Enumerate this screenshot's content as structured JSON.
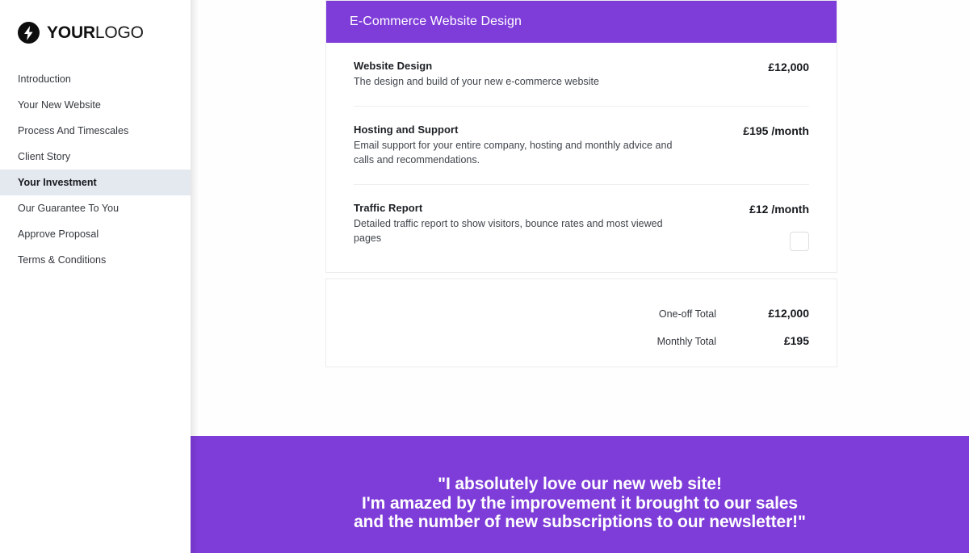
{
  "sidebar": {
    "logo": {
      "icon": "lightning-bolt-icon",
      "text_bold": "YOUR",
      "text_light": "LOGO"
    },
    "items": [
      {
        "label": "Introduction",
        "active": false
      },
      {
        "label": "Your New Website",
        "active": false
      },
      {
        "label": "Process And Timescales",
        "active": false
      },
      {
        "label": "Client Story",
        "active": false
      },
      {
        "label": "Your Investment",
        "active": true
      },
      {
        "label": "Our Guarantee To You",
        "active": false
      },
      {
        "label": "Approve Proposal",
        "active": false
      },
      {
        "label": "Terms & Conditions",
        "active": false
      }
    ]
  },
  "proposal": {
    "card_title": "E-Commerce Website Design",
    "line_items": [
      {
        "title": "Website Design",
        "description": "The design and build of your new e-commerce website",
        "price": "£12,000",
        "has_checkbox": false
      },
      {
        "title": "Hosting and Support",
        "description": "Email support for your entire company, hosting and monthly advice and calls and recommendations.",
        "price": "£195 /month",
        "has_checkbox": false
      },
      {
        "title": "Traffic Report",
        "description": "Detailed traffic report to show visitors, bounce rates and most viewed pages",
        "price": "£12 /month",
        "has_checkbox": true,
        "checkbox_checked": false
      }
    ],
    "totals": [
      {
        "label": "One-off Total",
        "value": "£12,000"
      },
      {
        "label": "Monthly Total",
        "value": "£195"
      }
    ]
  },
  "testimonial": {
    "lines": [
      "\"I absolutely love our new web site!",
      "I'm amazed by the improvement it brought to our sales",
      "and the number of new subscriptions to our newsletter!\""
    ]
  },
  "colors": {
    "accent_purple": "#7e3cd9",
    "sidebar_active": "#e4e8ef",
    "card_border": "#ececec"
  }
}
